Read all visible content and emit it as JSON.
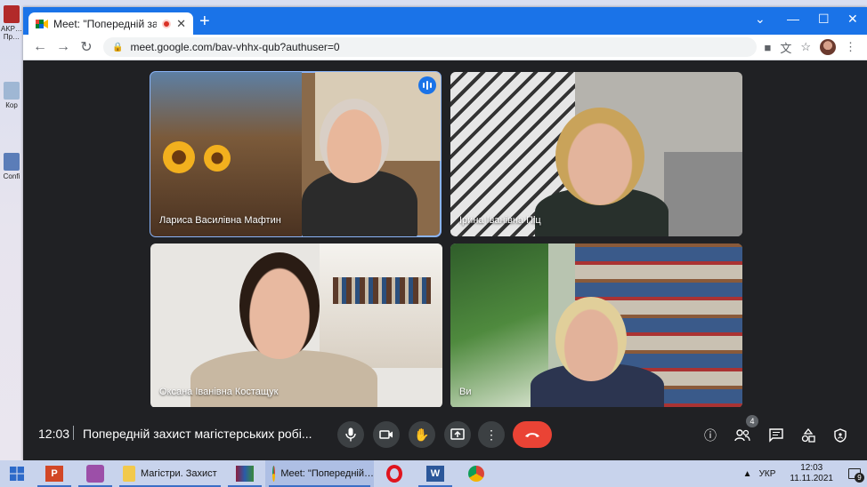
{
  "desktop": {
    "icons": [
      {
        "label": "AKP… Пр…"
      },
      {
        "label": "Кор"
      },
      {
        "label": "Confi"
      }
    ]
  },
  "browser": {
    "tab_title": "Meet: \"Попередній захист м",
    "new_tab": "+",
    "url": "meet.google.com/bav-vhhx-qub?authuser=0",
    "accent": "#1a73e8"
  },
  "participants": [
    {
      "name": "Лариса Василівна Мафтин",
      "speaking": true
    },
    {
      "name": "Ірина Іванівна Піц",
      "speaking": false
    },
    {
      "name": "Оксана Іванівна Костащук",
      "speaking": false
    },
    {
      "name": "Ви",
      "speaking": false
    }
  ],
  "meeting": {
    "time": "12:03",
    "title": "Попередній захист магістерських робі...",
    "participant_count": "4",
    "end_call_color": "#ea4335"
  },
  "taskbar": {
    "items": [
      {
        "label": "Магістри. Захист"
      },
      {
        "label": "Meet: \"Попередній…"
      }
    ],
    "language": "УКР",
    "clock_time": "12:03",
    "clock_date": "11.11.2021",
    "notifications": "9"
  }
}
